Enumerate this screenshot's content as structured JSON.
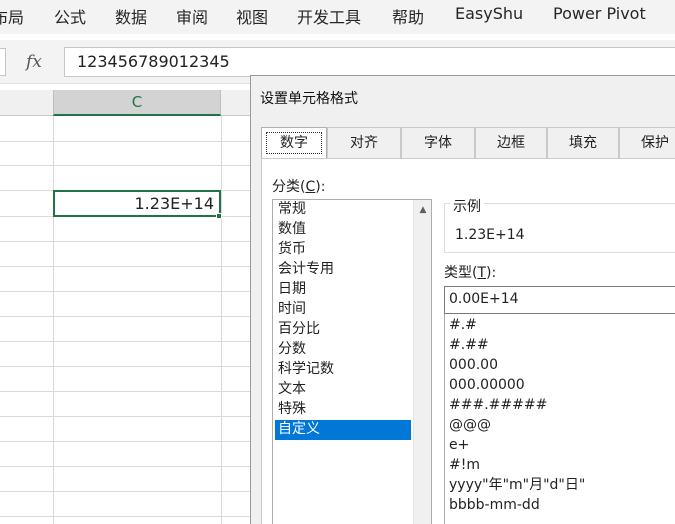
{
  "ribbon": {
    "tabs": [
      "布局",
      "公式",
      "数据",
      "审阅",
      "视图",
      "开发工具",
      "帮助",
      "EasyShu",
      "Power Pivot"
    ]
  },
  "formula_bar": {
    "fx_label": "fx",
    "value": "123456789012345"
  },
  "sheet": {
    "column_header": "C",
    "active_cell_display": "1.23E+14"
  },
  "dialog": {
    "title": "设置单元格格式",
    "tabs": [
      "数字",
      "对齐",
      "字体",
      "边框",
      "填充",
      "保护"
    ],
    "active_tab": "数字",
    "category_label": "分类(C):",
    "category_label_parts": {
      "before": "分类(",
      "key": "C",
      "after": "):"
    },
    "categories": [
      "常规",
      "数值",
      "货币",
      "会计专用",
      "日期",
      "时间",
      "百分比",
      "分数",
      "科学记数",
      "文本",
      "特殊",
      "自定义"
    ],
    "selected_category": "自定义",
    "sample_label": "示例",
    "sample_value": "1.23E+14",
    "type_label": "类型(T):",
    "type_label_parts": {
      "before": "类型(",
      "key": "T",
      "after": "):"
    },
    "type_value": "0.00E+14",
    "type_list": [
      "#.#",
      "#.##",
      "000.00",
      "000.00000",
      "###.#####",
      "@@@",
      "e+",
      "#!m",
      "yyyy\"年\"m\"月\"d\"日\"",
      "bbbb-mm-dd"
    ]
  },
  "colors": {
    "excel_green": "#217346",
    "selection_blue": "#0078d7"
  },
  "icons": {
    "scroll_up": "chevron-up-icon",
    "scroll_down": "chevron-down-icon"
  }
}
